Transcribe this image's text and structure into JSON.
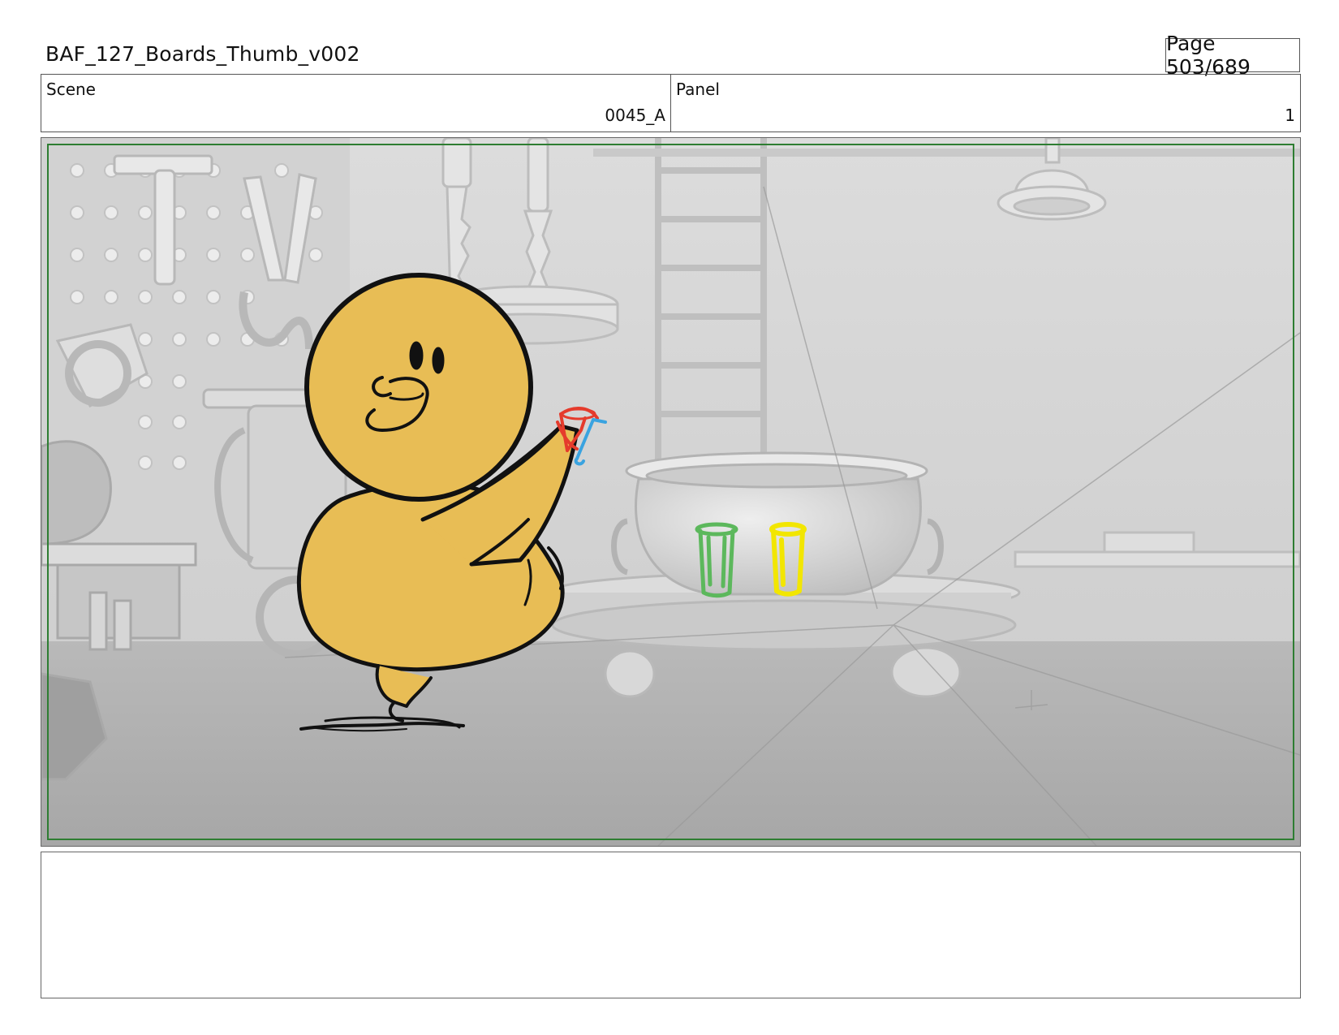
{
  "header": {
    "document_title": "BAF_127_Boards_Thumb_v002",
    "page_indicator": "Page 503/689"
  },
  "scene": {
    "label": "Scene",
    "value": "0045_A"
  },
  "panel": {
    "label": "Panel",
    "value": "1"
  },
  "artwork": {
    "safe_frame_color": "#2e7d32",
    "character_color": "#e8bd55",
    "cup_colors": [
      "#5cb85c",
      "#f2e600"
    ],
    "hand_prop_colors": [
      "#e53b2c",
      "#3aa3e0"
    ]
  },
  "notes": {
    "text": ""
  }
}
